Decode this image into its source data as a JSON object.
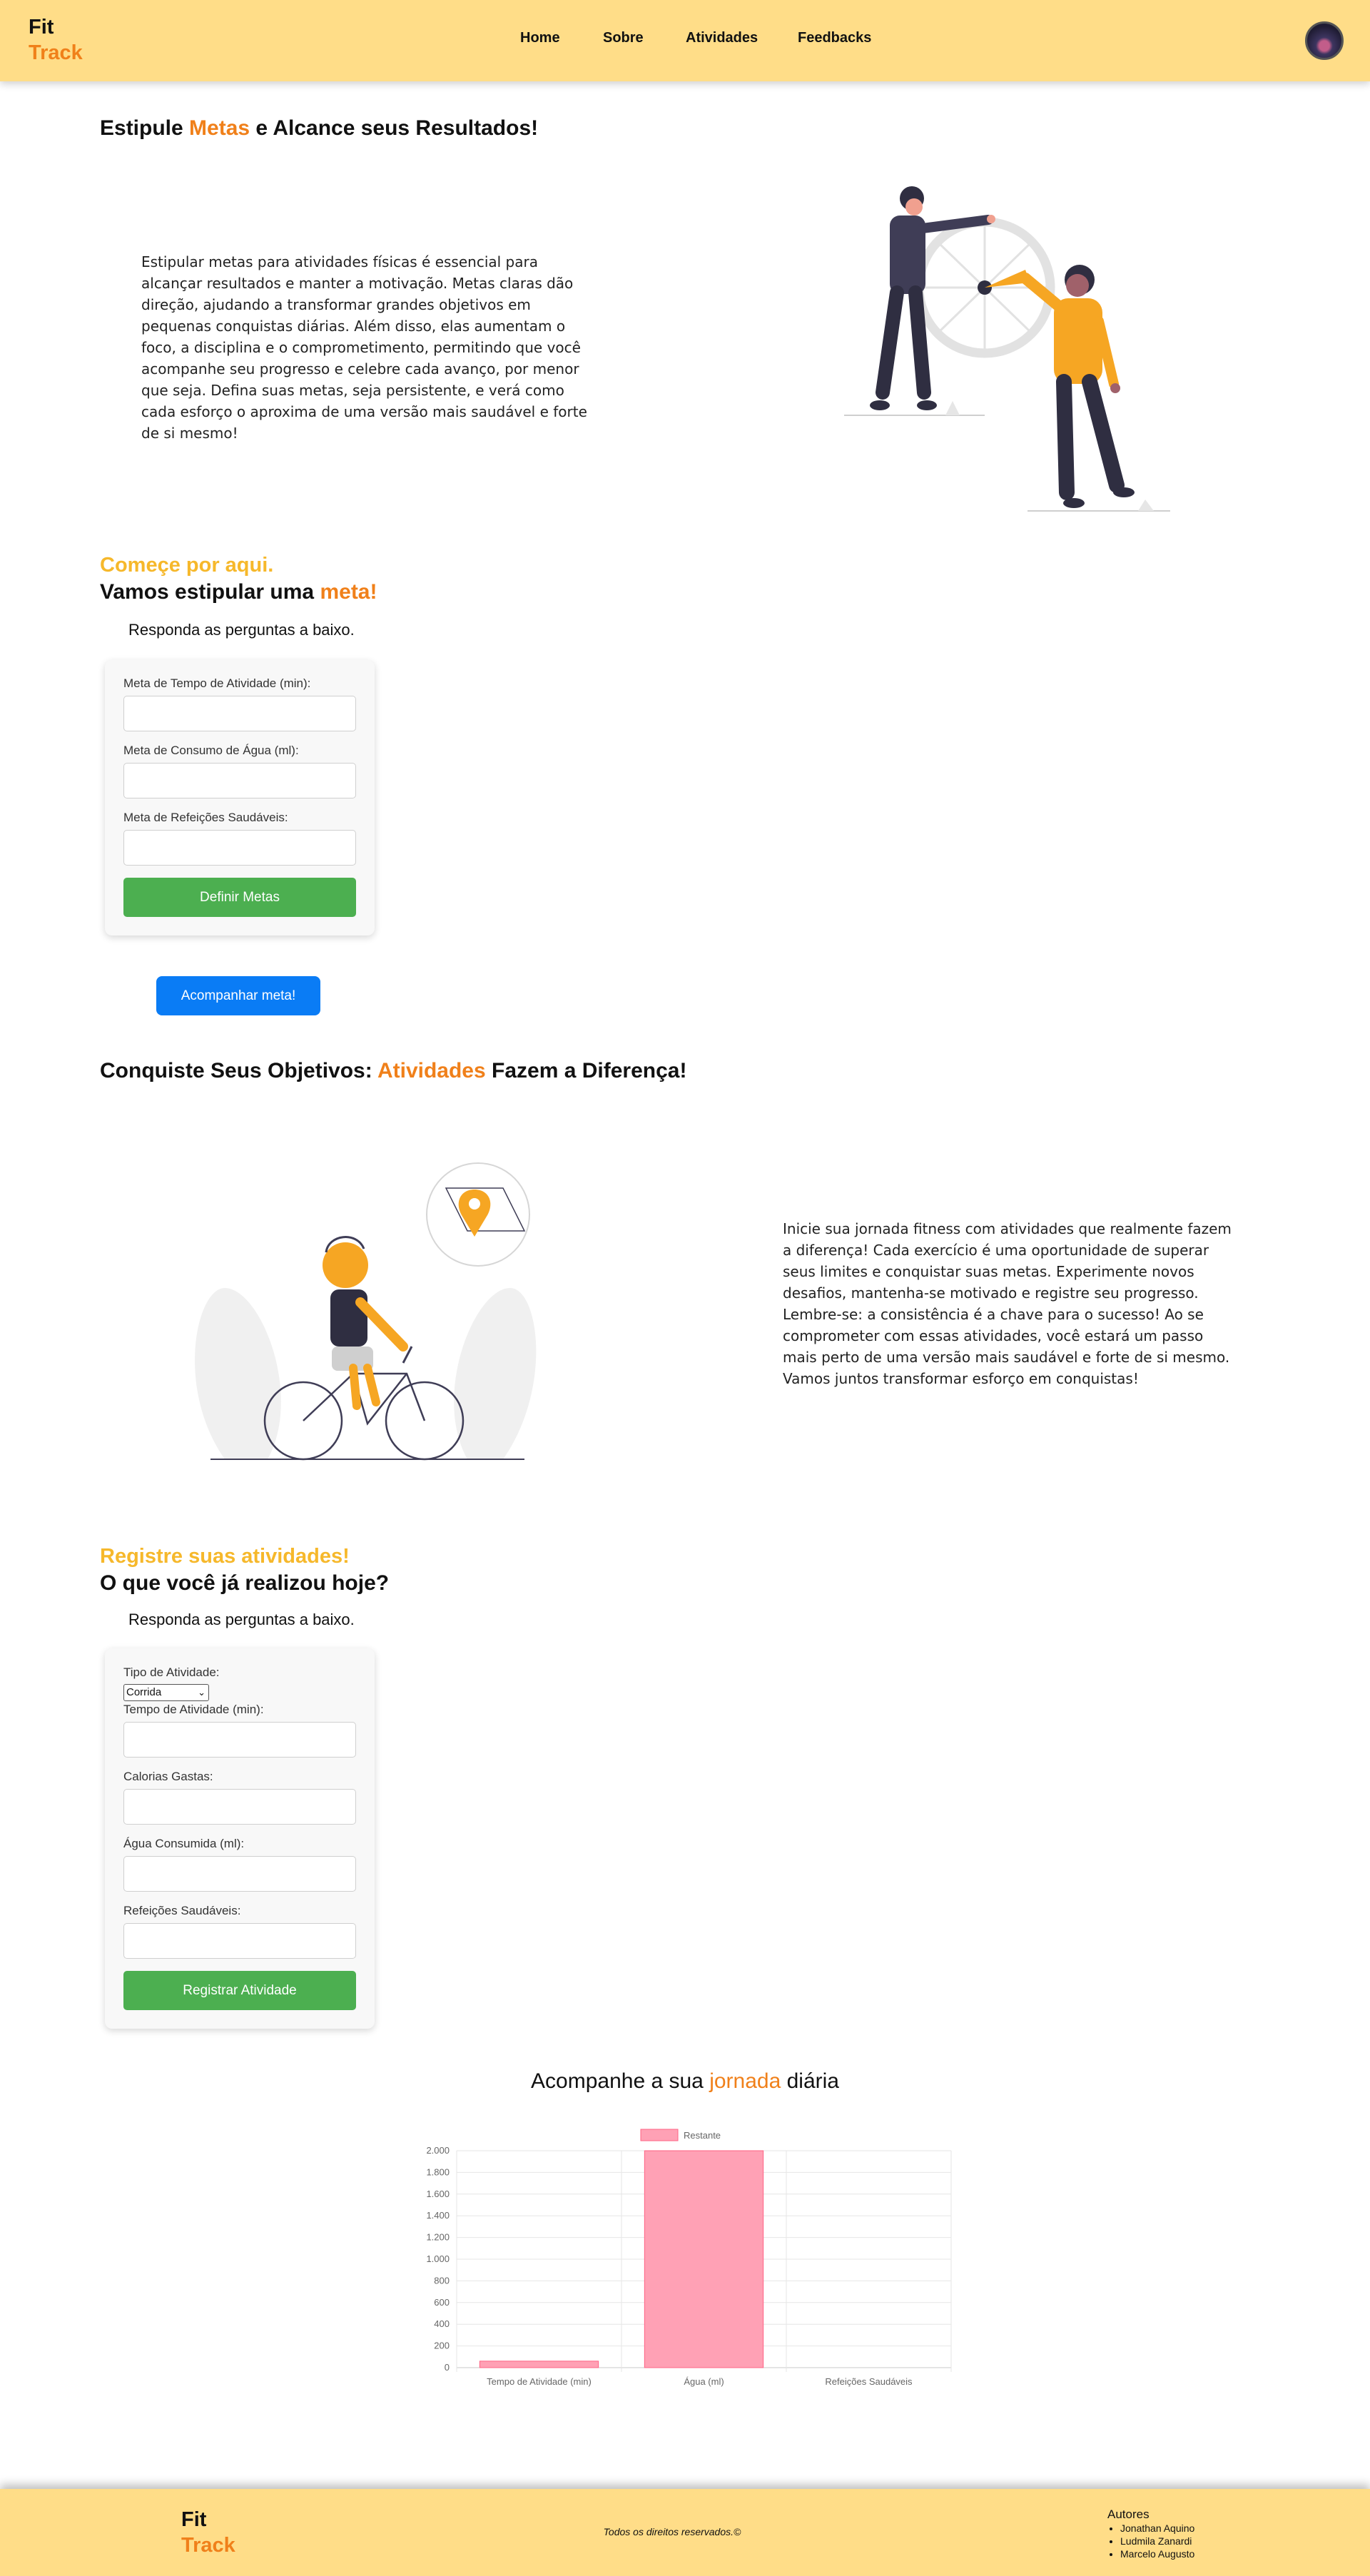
{
  "header": {
    "logo_line1": "Fit",
    "logo_line2": "Track",
    "nav": [
      "Home",
      "Sobre",
      "Atividades",
      "Feedbacks"
    ]
  },
  "section_metas": {
    "title_pre": "Estipule ",
    "title_highlight": "Metas",
    "title_post": " e Alcance seus Resultados!",
    "text": "Estipular metas para atividades físicas é essencial para alcançar resultados e manter a motivação. Metas claras dão direção, ajudando a transformar grandes objetivos em pequenas conquistas diárias. Além disso, elas aumentam o foco, a disciplina e o comprometimento, permitindo que você acompanhe seu progresso e celebre cada avanço, por menor que seja. Defina suas metas, seja persistente, e verá como cada esforço o aproxima de uma versão mais saudável e forte de si mesmo!"
  },
  "goal_form": {
    "kicker": "Começe por aqui.",
    "title_pre": "Vamos estipular uma ",
    "title_highlight": "meta!",
    "instructions": "Responda as perguntas a baixo.",
    "label_time": "Meta de Tempo de Atividade (min):",
    "label_water": "Meta de Consumo de Água (ml):",
    "label_meals": "Meta de Refeições Saudáveis:",
    "submit": "Definir Metas",
    "track_button": "Acompanhar meta!"
  },
  "section_atividades": {
    "title_pre": "Conquiste Seus Objetivos: ",
    "title_highlight": "Atividades",
    "title_post": " Fazem a Diferença!",
    "text": "Inicie sua jornada fitness com atividades que realmente fazem a diferença! Cada exercício é uma oportunidade de superar seus limites e conquistar suas metas. Experimente novos desafios, mantenha-se motivado e registre seu progresso. Lembre-se: a consistência é a chave para o sucesso! Ao se comprometer com essas atividades, você estará um passo mais perto de uma versão mais saudável e forte de si mesmo. Vamos juntos transformar esforço em conquistas!"
  },
  "activity_form": {
    "kicker": "Registre suas atividades!",
    "title": "O que você já realizou hoje?",
    "instructions": "Responda as perguntas a baixo.",
    "label_type": "Tipo de Atividade:",
    "type_selected": "Corrida",
    "label_time": "Tempo de Atividade (min):",
    "label_calories": "Calorias Gastas:",
    "label_water": "Água Consumida (ml):",
    "label_meals": "Refeições Saudáveis:",
    "submit": "Registrar Atividade"
  },
  "chart_section": {
    "title_pre": "Acompanhe a sua ",
    "title_highlight": "jornada",
    "title_post": " diária"
  },
  "chart_data": {
    "type": "bar",
    "categories": [
      "Tempo de Atividade (min)",
      "Água (ml)",
      "Refeições Saudáveis"
    ],
    "series": [
      {
        "name": "Restante",
        "values": [
          60,
          2000,
          0
        ]
      }
    ],
    "ylim": [
      0,
      2000
    ],
    "yticks": [
      "0",
      "200",
      "400",
      "600",
      "800",
      "1.000",
      "1.200",
      "1.400",
      "1.600",
      "1.800",
      "2.000"
    ],
    "grid": true,
    "legend": "top",
    "colors": {
      "bar_fill": "#ffa1b5",
      "bar_stroke": "#ff6384"
    }
  },
  "footer": {
    "logo_line1": "Fit",
    "logo_line2": "Track",
    "rights": "Todos os direitos reservados.©",
    "authors_title": "Autores",
    "authors": [
      "Jonathan Aquino",
      "Ludmila Zanardi",
      "Marcelo Augusto"
    ]
  },
  "colors": {
    "header_bg": "#ffdd88",
    "accent_orange": "#f0801a",
    "accent_yellow": "#f6b82b",
    "green_button": "#4caf50",
    "blue_button": "#0a7cf5"
  }
}
